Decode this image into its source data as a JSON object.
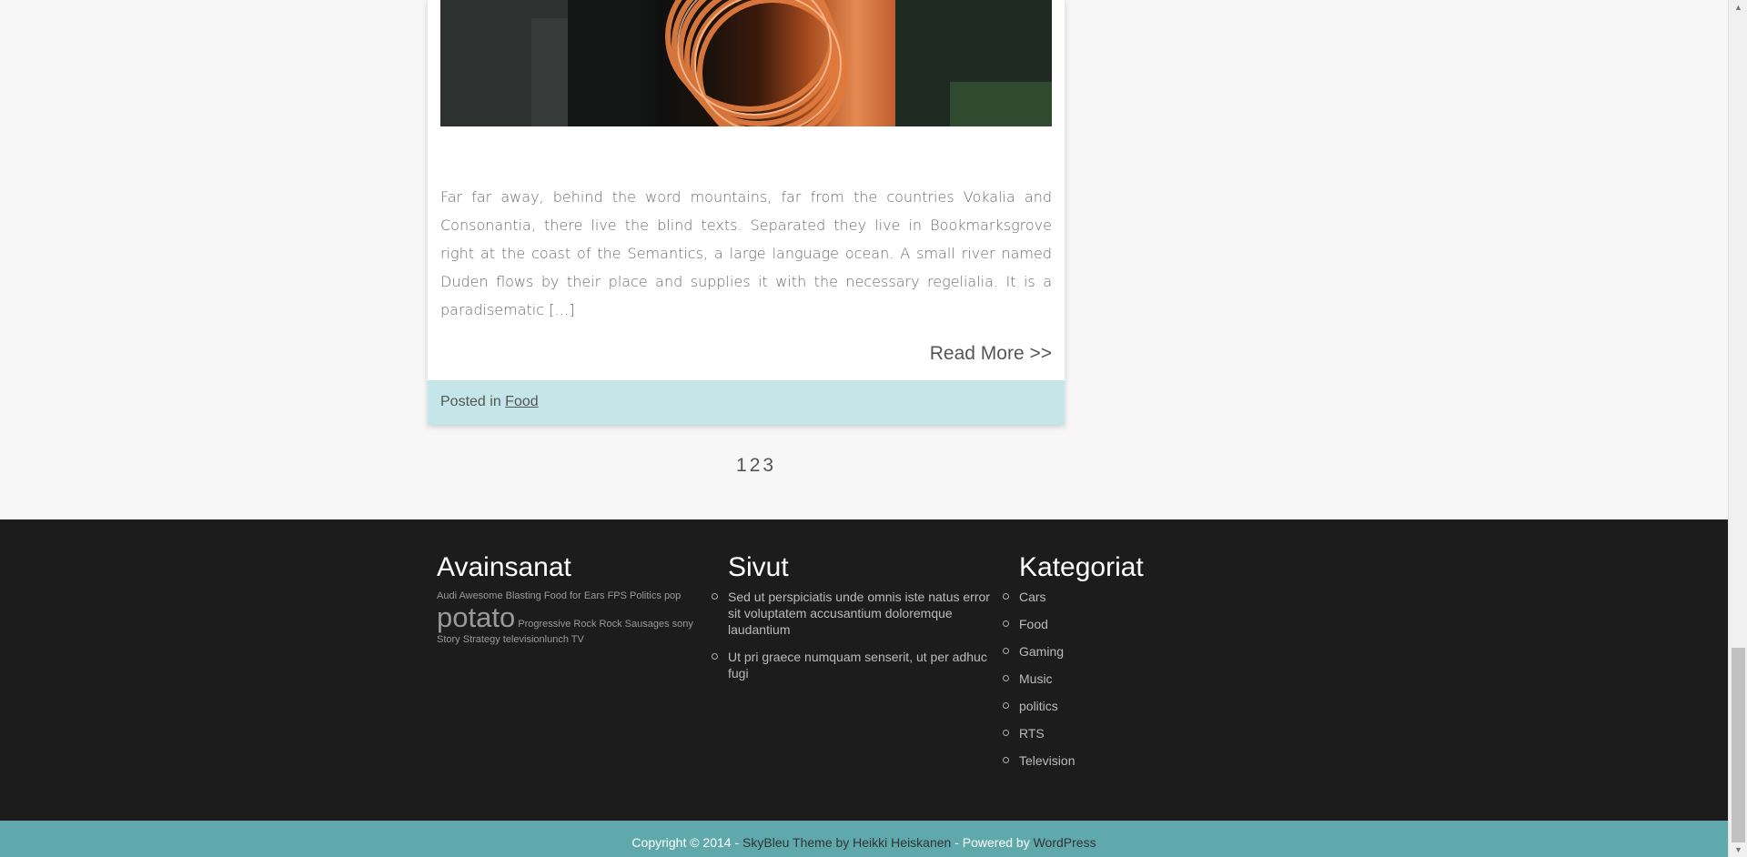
{
  "post": {
    "excerpt": "Far far away, behind the word mountains, far from the countries Vokalia and Consonantia, there live the blind texts. Separated they live in Bookmarksgrove right at the coast of the Semantics, a large language ocean. A small river named Duden flows by their place and supplies it with the necessary regelialia. It is a paradisematic […]",
    "read_more": "Read More >>",
    "posted_in_label": "Posted in",
    "category": "Food"
  },
  "pagination": [
    "1",
    "2",
    "3"
  ],
  "footer": {
    "tags": {
      "title": "Avainsanat",
      "items": [
        {
          "label": "Audi"
        },
        {
          "label": "Awesome"
        },
        {
          "label": "Blasting"
        },
        {
          "label": "Food for Ears"
        },
        {
          "label": "FPS"
        },
        {
          "label": "Politics"
        },
        {
          "label": "pop"
        },
        {
          "label": "potato"
        },
        {
          "label": "Progressive Rock"
        },
        {
          "label": "Rock"
        },
        {
          "label": "Sausages"
        },
        {
          "label": "sony"
        },
        {
          "label": "Story"
        },
        {
          "label": "Strategy"
        },
        {
          "label": "televisionlunch"
        },
        {
          "label": "TV"
        }
      ]
    },
    "pages": {
      "title": "Sivut",
      "items": [
        "Sed ut perspiciatis unde omnis iste natus error sit voluptatem accusantium doloremque laudantium",
        "Ut pri graece numquam senserit, ut per adhuc fugi"
      ]
    },
    "categories": {
      "title": "Kategoriat",
      "items": [
        "Cars",
        "Food",
        "Gaming",
        "Music",
        "politics",
        "RTS",
        "Television"
      ]
    },
    "copyright": {
      "prefix": "Copyright © 2014 - ",
      "theme_link": "SkyBleu Theme by Heikki Heiskanen",
      "middle": " - Powered by ",
      "wp_link": "WordPress"
    }
  },
  "colors": {
    "footer_bg": "#1c1c1c",
    "copyright_bg": "#5fa9ad",
    "post_footer_bg": "#c4e6e8"
  },
  "icons": {
    "scroll_up": "scroll-up-arrow-icon",
    "scroll_down": "scroll-down-arrow-icon"
  }
}
